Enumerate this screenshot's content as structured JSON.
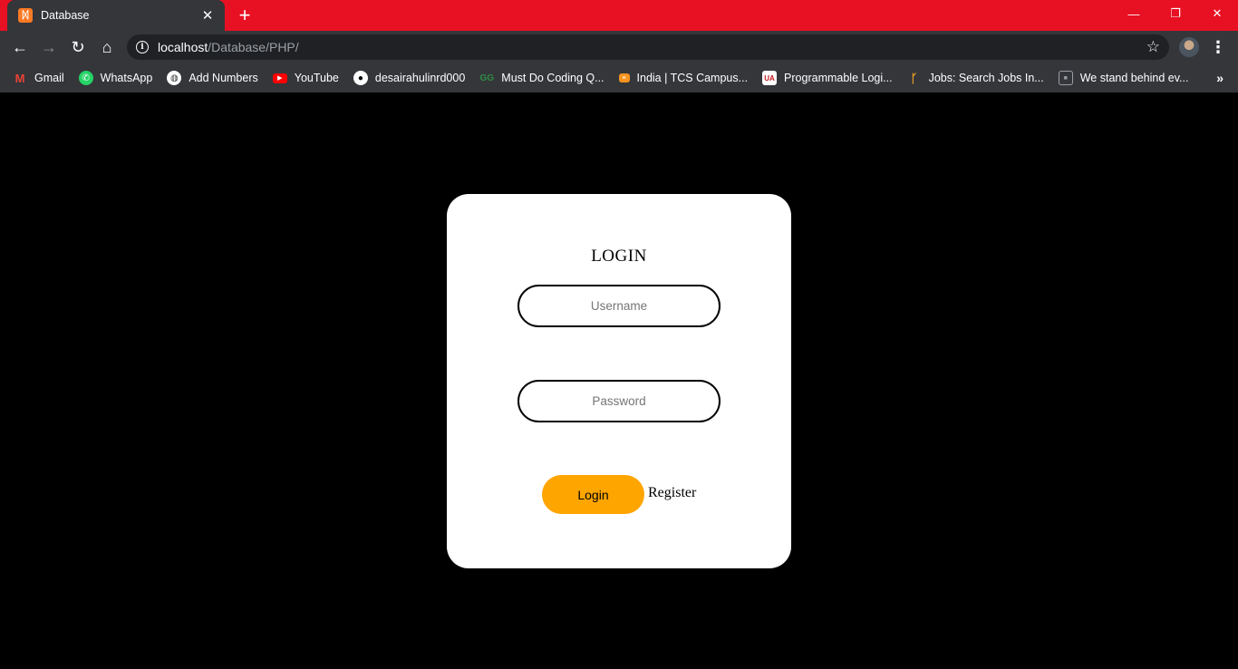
{
  "browser": {
    "tab": {
      "title": "Database",
      "favicon": "xampp-icon"
    },
    "url": {
      "host": "localhost",
      "path": "/Database/PHP/"
    },
    "bookmarks": [
      {
        "label": "Gmail",
        "icon": "gmail-icon",
        "color": "#ea4335"
      },
      {
        "label": "WhatsApp",
        "icon": "whatsapp-icon",
        "color": "#25d366"
      },
      {
        "label": "Add Numbers",
        "icon": "globe-icon",
        "color": "#ffffff"
      },
      {
        "label": "YouTube",
        "icon": "youtube-icon",
        "color": "#ff0000"
      },
      {
        "label": "desairahulinrd000",
        "icon": "github-icon",
        "color": "#ffffff"
      },
      {
        "label": "Must Do Coding Q...",
        "icon": "geeksforgeeks-icon",
        "color": "#2f8d46"
      },
      {
        "label": "India | TCS Campus...",
        "icon": "tcs-icon",
        "color": "#f7931e"
      },
      {
        "label": "Programmable Logi...",
        "icon": "logic-icon",
        "color": "#c4161c"
      },
      {
        "label": "Jobs: Search Jobs In...",
        "icon": "jobs-icon",
        "color": "#f5a623"
      },
      {
        "label": "We stand behind ev...",
        "icon": "square-icon",
        "color": "#9aa0a6"
      }
    ],
    "theme_color": "#e81123"
  },
  "login_card": {
    "title": "LOGIN",
    "username_placeholder": "Username",
    "password_placeholder": "Password",
    "login_label": "Login",
    "register_label": "Register",
    "accent": "#ffa500"
  }
}
